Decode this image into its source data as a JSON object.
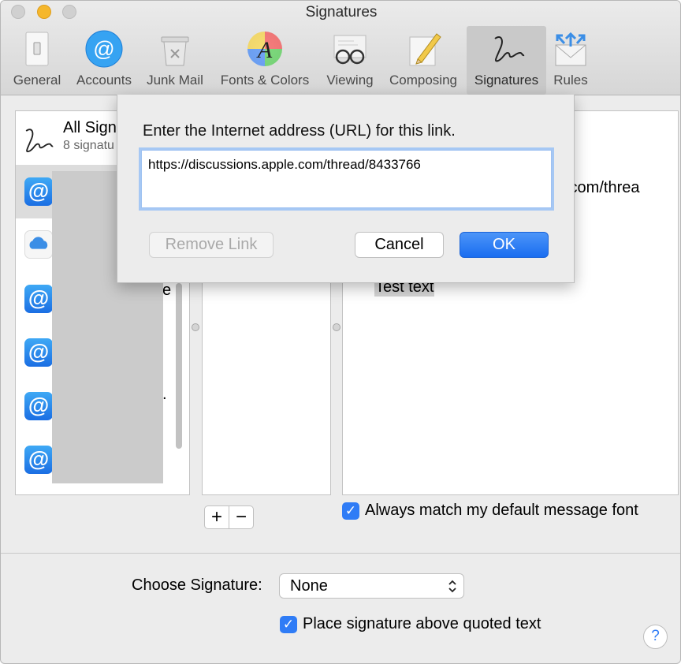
{
  "window": {
    "title": "Signatures"
  },
  "toolbar": {
    "items": [
      {
        "label": "General"
      },
      {
        "label": "Accounts"
      },
      {
        "label": "Junk Mail"
      },
      {
        "label": "Fonts & Colors"
      },
      {
        "label": "Viewing"
      },
      {
        "label": "Composing"
      },
      {
        "label": "Signatures",
        "selected": true
      },
      {
        "label": "Rules"
      }
    ]
  },
  "accounts_panel": {
    "all_signatures_title": "All Sign",
    "all_signatures_count": "8 signatu",
    "partial_text_1": "e",
    "partial_text_2": "."
  },
  "preview": {
    "partial_url": ".com/threa",
    "text": "Test text"
  },
  "options": {
    "match_font_label": "Always match my default message font",
    "match_font_checked": true,
    "choose_signature_label": "Choose Signature:",
    "choose_signature_value": "None",
    "place_above_label": "Place signature above quoted text",
    "place_above_checked": true
  },
  "buttons": {
    "add": "+",
    "remove": "−",
    "help": "?"
  },
  "sheet": {
    "prompt": "Enter the Internet address (URL) for this link.",
    "url_value": "https://discussions.apple.com/thread/8433766",
    "remove_link_label": "Remove Link",
    "cancel_label": "Cancel",
    "ok_label": "OK"
  },
  "colors": {
    "accent": "#2f7cf6",
    "ok_button": "#1f74f2"
  }
}
